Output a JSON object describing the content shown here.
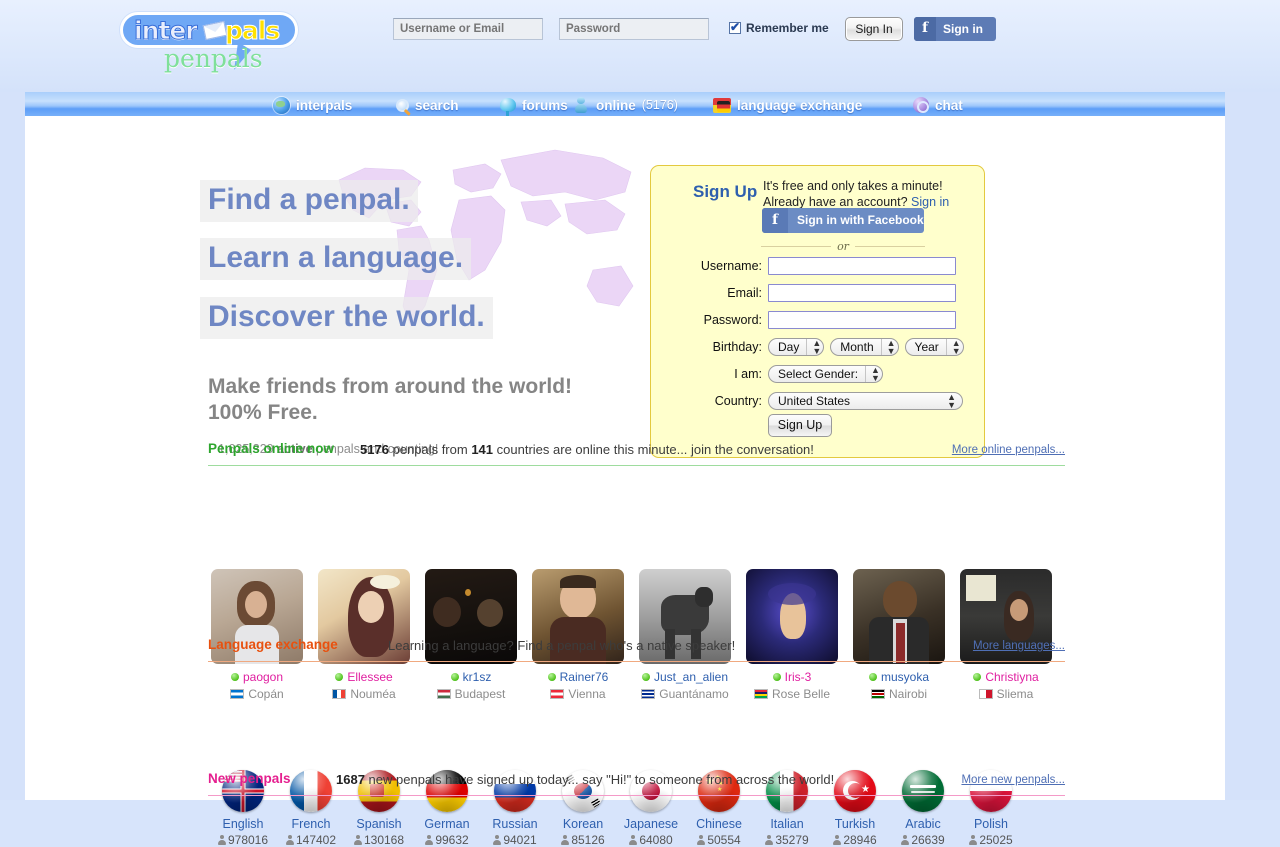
{
  "brand": {
    "logo_inter": "inter",
    "logo_pals": "pals",
    "logo_sub": "penpals"
  },
  "login": {
    "username_placeholder": "Username or Email",
    "password_placeholder": "Password",
    "remember_label": "Remember me",
    "signin_label": "Sign In",
    "facebook_label": "Sign in",
    "facebook_f": "f"
  },
  "nav": {
    "items": [
      {
        "label": "interpals",
        "icon": "globe-icon",
        "count": ""
      },
      {
        "label": "search",
        "icon": "magnifier-icon",
        "count": ""
      },
      {
        "label": "forums",
        "icon": "speech-bubble-icon",
        "count": ""
      },
      {
        "label": "online",
        "icon": "person-icon",
        "count": "(5176)"
      },
      {
        "label": "language exchange",
        "icon": "flags-icon",
        "count": ""
      },
      {
        "label": "chat",
        "icon": "chat-icon",
        "count": ""
      }
    ]
  },
  "hero": {
    "line1": "Find a penpal.",
    "line2": "Learn a language.",
    "line3": "Discover the world.",
    "sub1": "Make friends from around the world!",
    "sub2": "100% Free.",
    "counter_number": "1,625,329",
    "counter_bold": "active",
    "counter_rest": "penpals and counting!"
  },
  "signup": {
    "title": "Sign Up",
    "blurb_line1": "It's free and only takes a minute!",
    "blurb_line2_pre": "Already have an account? ",
    "blurb_signin_link": "Sign in",
    "facebook_button": "Sign in with Facebook",
    "facebook_f": "f",
    "or": "or",
    "label_username": "Username:",
    "label_email": "Email:",
    "label_password": "Password:",
    "label_birthday": "Birthday:",
    "label_iam": "I am:",
    "label_country": "Country:",
    "value_username": "",
    "value_email": "",
    "value_password": "",
    "birthday_day": "Day",
    "birthday_month": "Month",
    "birthday_year": "Year",
    "gender": "Select Gender:",
    "country": "United States",
    "submit": "Sign Up"
  },
  "online_section": {
    "title": "Penpals online now",
    "title_color": "#2ea62e",
    "count": "5176",
    "text_mid": "penpals from",
    "countries": "141",
    "text_end": "countries are online this minute... join the conversation!",
    "more": "More online penpals...",
    "penpals": [
      {
        "name": "paogon",
        "gender": "female",
        "city": "Copán",
        "flag": "Honduras"
      },
      {
        "name": "Ellessee",
        "gender": "female",
        "city": "Nouméa",
        "flag": "France"
      },
      {
        "name": "kr1sz",
        "gender": "male",
        "city": "Budapest",
        "flag": "Hungary"
      },
      {
        "name": "Rainer76",
        "gender": "male",
        "city": "Vienna",
        "flag": "Austria"
      },
      {
        "name": "Just_an_alien",
        "gender": "male",
        "city": "Guantánamo",
        "flag": "Cuba"
      },
      {
        "name": "Iris-3",
        "gender": "female",
        "city": "Rose Belle",
        "flag": "Mauritius"
      },
      {
        "name": "musyoka",
        "gender": "male",
        "city": "Nairobi",
        "flag": "Kenya"
      },
      {
        "name": "Christiyna",
        "gender": "female",
        "city": "Sliema",
        "flag": "Malta"
      }
    ]
  },
  "language_section": {
    "title": "Language exchange",
    "title_color": "#e8510f",
    "text": "Learning a language? Find a penpal who's a native speaker!",
    "more": "More languages...",
    "languages": [
      {
        "name": "English",
        "count": "978016"
      },
      {
        "name": "French",
        "count": "147402"
      },
      {
        "name": "Spanish",
        "count": "130168"
      },
      {
        "name": "German",
        "count": "99632"
      },
      {
        "name": "Russian",
        "count": "94021"
      },
      {
        "name": "Korean",
        "count": "85126"
      },
      {
        "name": "Japanese",
        "count": "64080"
      },
      {
        "name": "Chinese",
        "count": "50554"
      },
      {
        "name": "Italian",
        "count": "35279"
      },
      {
        "name": "Turkish",
        "count": "28946"
      },
      {
        "name": "Arabic",
        "count": "26639"
      },
      {
        "name": "Polish",
        "count": "25025"
      }
    ]
  },
  "new_section": {
    "title": "New penpals",
    "title_color": "#e51f8f",
    "count": "1687",
    "text": "new penpals have signed up today... say \"Hi!\" to someone from across the world!",
    "more": "More new penpals..."
  }
}
